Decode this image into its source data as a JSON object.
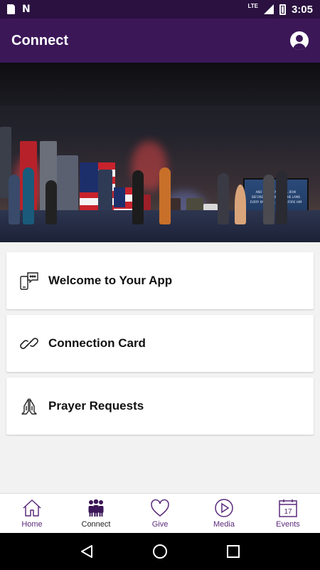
{
  "status_bar": {
    "network": "LTE",
    "time": "3:05",
    "icons": [
      "sd-card-icon",
      "n-notification-icon",
      "signal-icon",
      "battery-icon"
    ]
  },
  "app_bar": {
    "title": "Connect",
    "profile_icon": "account-circle-icon"
  },
  "hero": {
    "screen_lines": [
      "AND EVERY KNEE WILL BOW",
      "BEFORE THE LION AND THE LAMB",
      "EVERY KNEE WILL BOW BEFORE HIM"
    ],
    "banners": [
      "COAST GUARD",
      "FORCE",
      "NAVY",
      "ARMY"
    ]
  },
  "cards": [
    {
      "label": "Welcome to Your App",
      "icon": "chat-phone-icon"
    },
    {
      "label": "Connection Card",
      "icon": "link-icon"
    },
    {
      "label": "Prayer Requests",
      "icon": "praying-hands-icon"
    }
  ],
  "bottom_nav": {
    "active": "Connect",
    "items": [
      {
        "label": "Home",
        "icon": "home-icon"
      },
      {
        "label": "Connect",
        "icon": "people-icon"
      },
      {
        "label": "Give",
        "icon": "heart-icon"
      },
      {
        "label": "Media",
        "icon": "play-circle-icon"
      },
      {
        "label": "Events",
        "icon": "calendar-icon",
        "day": "17"
      }
    ]
  },
  "colors": {
    "status_bar": "#2a1140",
    "app_bar": "#3b1758",
    "accent": "#5a2a7a",
    "background": "#f2f2f2"
  }
}
